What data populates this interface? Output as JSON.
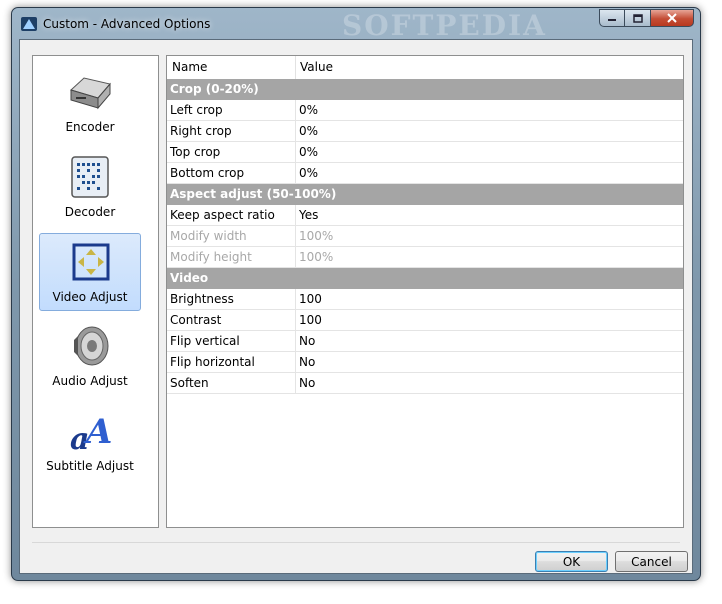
{
  "window": {
    "title": "Custom - Advanced Options",
    "watermark": "SOFTPEDIA"
  },
  "caption_buttons": {
    "minimize_icon": "minimize-icon",
    "maximize_icon": "maximize-icon",
    "close_icon": "close-icon"
  },
  "nav": {
    "items": [
      {
        "label": "Encoder",
        "icon": "encoder-icon",
        "selected": false
      },
      {
        "label": "Decoder",
        "icon": "decoder-icon",
        "selected": false
      },
      {
        "label": "Video Adjust",
        "icon": "video-adjust-icon",
        "selected": true
      },
      {
        "label": "Audio Adjust",
        "icon": "audio-adjust-icon",
        "selected": false
      },
      {
        "label": "Subtitle Adjust",
        "icon": "subtitle-adjust-icon",
        "selected": false
      }
    ]
  },
  "grid": {
    "headers": [
      "Name",
      "Value"
    ],
    "rows": [
      {
        "type": "section",
        "name": "Crop (0-20%)"
      },
      {
        "type": "prop",
        "name": "Left crop",
        "value": "0%"
      },
      {
        "type": "prop",
        "name": "Right crop",
        "value": "0%"
      },
      {
        "type": "prop",
        "name": "Top crop",
        "value": "0%"
      },
      {
        "type": "prop",
        "name": "Bottom crop",
        "value": "0%"
      },
      {
        "type": "section",
        "name": "Aspect adjust (50-100%)"
      },
      {
        "type": "prop",
        "name": "Keep aspect ratio",
        "value": "Yes"
      },
      {
        "type": "disabled",
        "name": "Modify width",
        "value": "100%"
      },
      {
        "type": "disabled",
        "name": "Modify height",
        "value": "100%"
      },
      {
        "type": "section",
        "name": "Video"
      },
      {
        "type": "prop",
        "name": "Brightness",
        "value": "100"
      },
      {
        "type": "prop",
        "name": "Contrast",
        "value": "100"
      },
      {
        "type": "prop",
        "name": "Flip vertical",
        "value": "No"
      },
      {
        "type": "prop",
        "name": "Flip horizontal",
        "value": "No"
      },
      {
        "type": "prop",
        "name": "Soften",
        "value": "No"
      }
    ]
  },
  "buttons": {
    "ok": "OK",
    "cancel": "Cancel"
  },
  "colors": {
    "section_bg": "#a5a5a5",
    "selection_bg": "#c2dcfd",
    "close_button": "#c44d35"
  }
}
